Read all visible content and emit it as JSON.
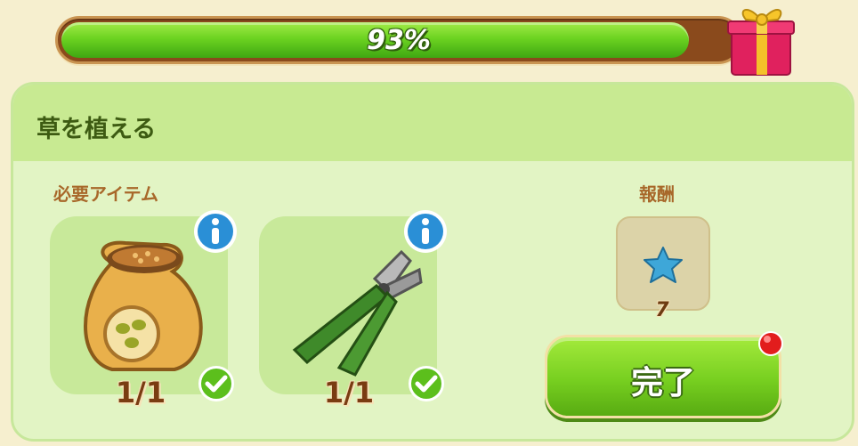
{
  "progress": {
    "percent_text": "93%",
    "value": 0.93
  },
  "panel": {
    "title": "草を植える"
  },
  "required": {
    "label": "必要アイテム",
    "items": [
      {
        "name": "seed-bag",
        "count": "1/1",
        "done": true
      },
      {
        "name": "pruning-shears",
        "count": "1/1",
        "done": true
      }
    ]
  },
  "reward": {
    "label": "報酬",
    "count": "7",
    "icon": "blue-star"
  },
  "actions": {
    "complete_label": "完了"
  },
  "colors": {
    "accent_green": "#6cd321",
    "panel_bg": "#e2f4c4",
    "header_bg": "#c8ea92",
    "label_brown": "#a8682a",
    "star_blue": "#3ea7d8"
  }
}
